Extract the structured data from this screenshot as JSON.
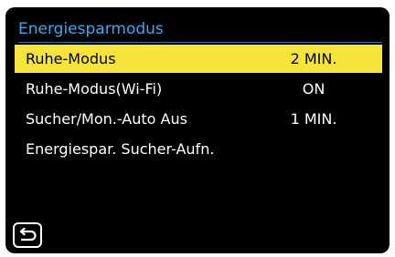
{
  "menu": {
    "title": "Energiesparmodus",
    "items": [
      {
        "label": "Ruhe-Modus",
        "value": "2 MIN.",
        "selected": true
      },
      {
        "label": "Ruhe-Modus(Wi-Fi)",
        "value": "ON",
        "selected": false
      },
      {
        "label": "Sucher/Mon.-Auto Aus",
        "value": "1 MIN.",
        "selected": false
      },
      {
        "label": "Energiespar. Sucher-Aufn.",
        "value": "",
        "selected": false
      }
    ]
  },
  "icons": {
    "back": "return-arrow-icon"
  },
  "colors": {
    "title": "#3aa9f0",
    "highlight": "#f6e33b",
    "background": "#000000",
    "text": "#ffffff"
  }
}
